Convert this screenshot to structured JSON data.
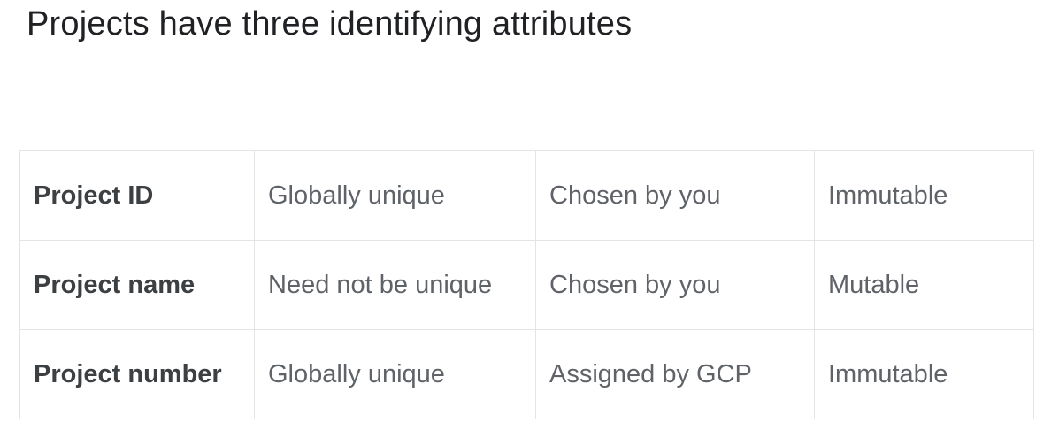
{
  "title": "Projects have three identifying attributes",
  "table": {
    "rows": [
      {
        "attribute": "Project ID",
        "uniqueness": "Globally unique",
        "assignment": "Chosen by you",
        "mutability": "Immutable"
      },
      {
        "attribute": "Project name",
        "uniqueness": "Need not be unique",
        "assignment": "Chosen by you",
        "mutability": "Mutable"
      },
      {
        "attribute": "Project number",
        "uniqueness": "Globally unique",
        "assignment": "Assigned by GCP",
        "mutability": "Immutable"
      }
    ]
  }
}
